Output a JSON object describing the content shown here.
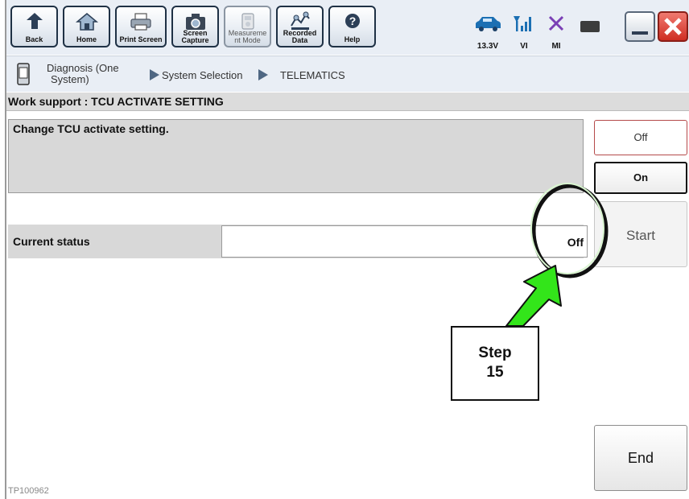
{
  "toolbar": {
    "back": "Back",
    "home": "Home",
    "print_screen": "Print Screen",
    "screen_capture": "Screen Capture",
    "measurement_mode": "Measureme nt Mode",
    "recorded_data": "Recorded Data",
    "help": "Help"
  },
  "status": {
    "voltage": "13.3V",
    "vi": "VI",
    "mi": "MI"
  },
  "breadcrumb": {
    "diagnosis_line1": "Diagnosis (One",
    "diagnosis_line2": "System)",
    "system_selection": "System Selection",
    "telematics": "TELEMATICS"
  },
  "page": {
    "title": "Work support : TCU ACTIVATE SETTING",
    "description": "Change TCU activate setting.",
    "current_status_label": "Current status",
    "current_status_value": "Off"
  },
  "buttons": {
    "off": "Off",
    "on": "On",
    "start": "Start",
    "end": "End"
  },
  "annotation": {
    "step_line1": "Step",
    "step_line2": "15",
    "image_id": "TP100962"
  },
  "colors": {
    "arrow_fill": "#33e51a",
    "close_button": "#d93a2f",
    "toolbar_bg": "#e9eef5"
  }
}
